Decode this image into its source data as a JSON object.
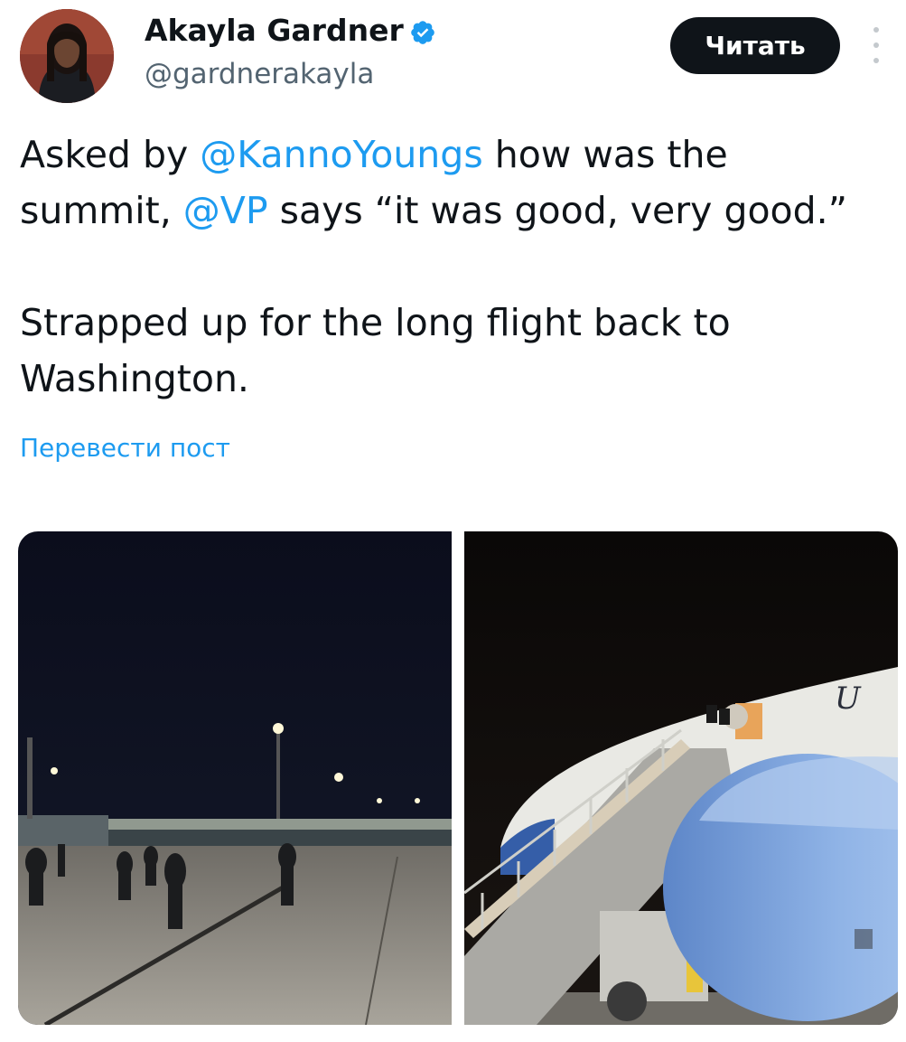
{
  "author": {
    "name": "Akayla Gardner",
    "handle": "@gardnerakayla",
    "verified": true
  },
  "follow_button": {
    "label": "Читать"
  },
  "tweet": {
    "line1": {
      "before": "Asked by ",
      "mention1": "@KannoYoungs",
      "after1": " how was the",
      "next": "summit, ",
      "mention2": "@VP",
      "after2": " says “it was good, very good.”"
    },
    "paragraph2": "Strapped up for the long flight back to Washington."
  },
  "translate_link": "Перевести пост",
  "colors": {
    "link": "#1d9bf0",
    "text": "#0f1419",
    "secondary": "#536471",
    "button_bg": "#0f1419"
  },
  "icons": [
    "verified-badge-icon",
    "more-options-icon"
  ],
  "media": {
    "count": 2,
    "photo1": {
      "aircraft_text": ""
    },
    "photo2": {
      "aircraft_text": "U"
    }
  }
}
